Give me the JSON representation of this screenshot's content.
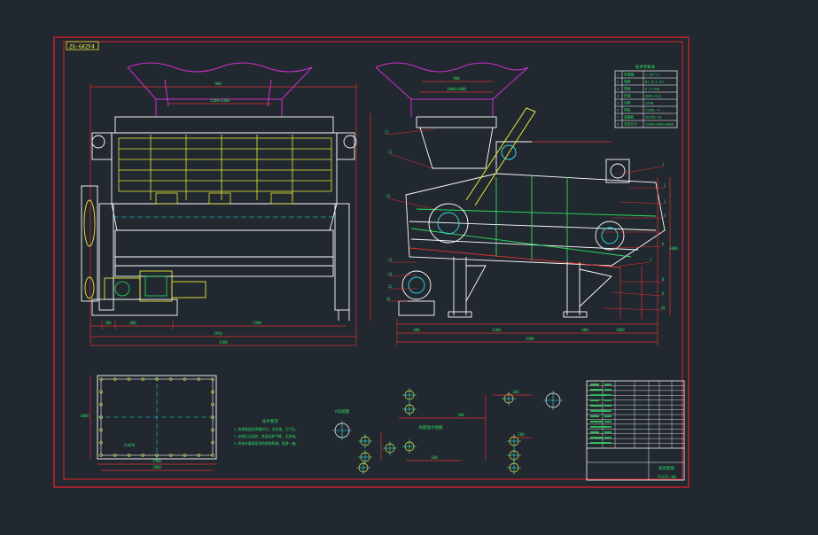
{
  "drawing": {
    "title_tag": "ZG-GKZF4",
    "colors": {
      "background": "#212830",
      "border": "#e0202a",
      "outline": "#ffffff",
      "hopper": "#d030d0",
      "yellow": "#e8e838",
      "green": "#30e060",
      "cyan": "#30e0e0",
      "dimension": "#e03030"
    },
    "front_view": {
      "dims": {
        "top": "900",
        "inner_top": "1200~1300",
        "overall": "3390",
        "lower": "2950",
        "base_left": "800",
        "base_right": "1200",
        "stub": "300"
      }
    },
    "side_view": {
      "dims": {
        "top": "900",
        "inner_top": "1600×1000",
        "overall": "3390",
        "base_a": "400",
        "base_b": "1200",
        "base_c": "600",
        "base_d": "1000",
        "height": "3000"
      },
      "balloons": [
        "1",
        "2",
        "3",
        "4",
        "5",
        "6",
        "7",
        "8",
        "9",
        "10",
        "11",
        "12",
        "13",
        "14",
        "15",
        "16",
        "17"
      ]
    },
    "spec_table": {
      "title": "技术参数表",
      "rows": [
        [
          "1",
          "处理量",
          "1.5m³/s"
        ],
        [
          "2",
          "规格",
          "Φ1.0~1.5m"
        ],
        [
          "3",
          "筛面",
          "0.5~1mm"
        ],
        [
          "4",
          "转速",
          "300r/min"
        ],
        [
          "5",
          "功率",
          "15kW"
        ],
        [
          "6",
          "电机",
          "Y180L-4"
        ],
        [
          "7",
          "减速机",
          "ZQ350-20"
        ],
        [
          "8",
          "外形尺寸",
          "3390×2500×3000"
        ]
      ]
    },
    "plan_view": {
      "dims": {
        "width": "1800",
        "inner": "1500",
        "height": "1000"
      },
      "inner_label": "3×Φ20"
    },
    "notes": {
      "title": "技术要求",
      "lines": [
        "1.各焊接部位焊缝均匀，无夹渣，无气孔。",
        "2.安装后试运转，各部运转平稳，无异响。",
        "3.所有外露表面涂防锈漆两遍，面漆一遍。"
      ]
    },
    "detail_views": {
      "label_a": "A向视图",
      "label_b": "局部放大视图",
      "dim_a": "500",
      "dim_b": "200",
      "dim_c": "180",
      "dim_d": "100"
    },
    "title_block": {
      "drawing_name": "总装配图",
      "drawing_no": "TA125-00",
      "rows": 14
    }
  }
}
